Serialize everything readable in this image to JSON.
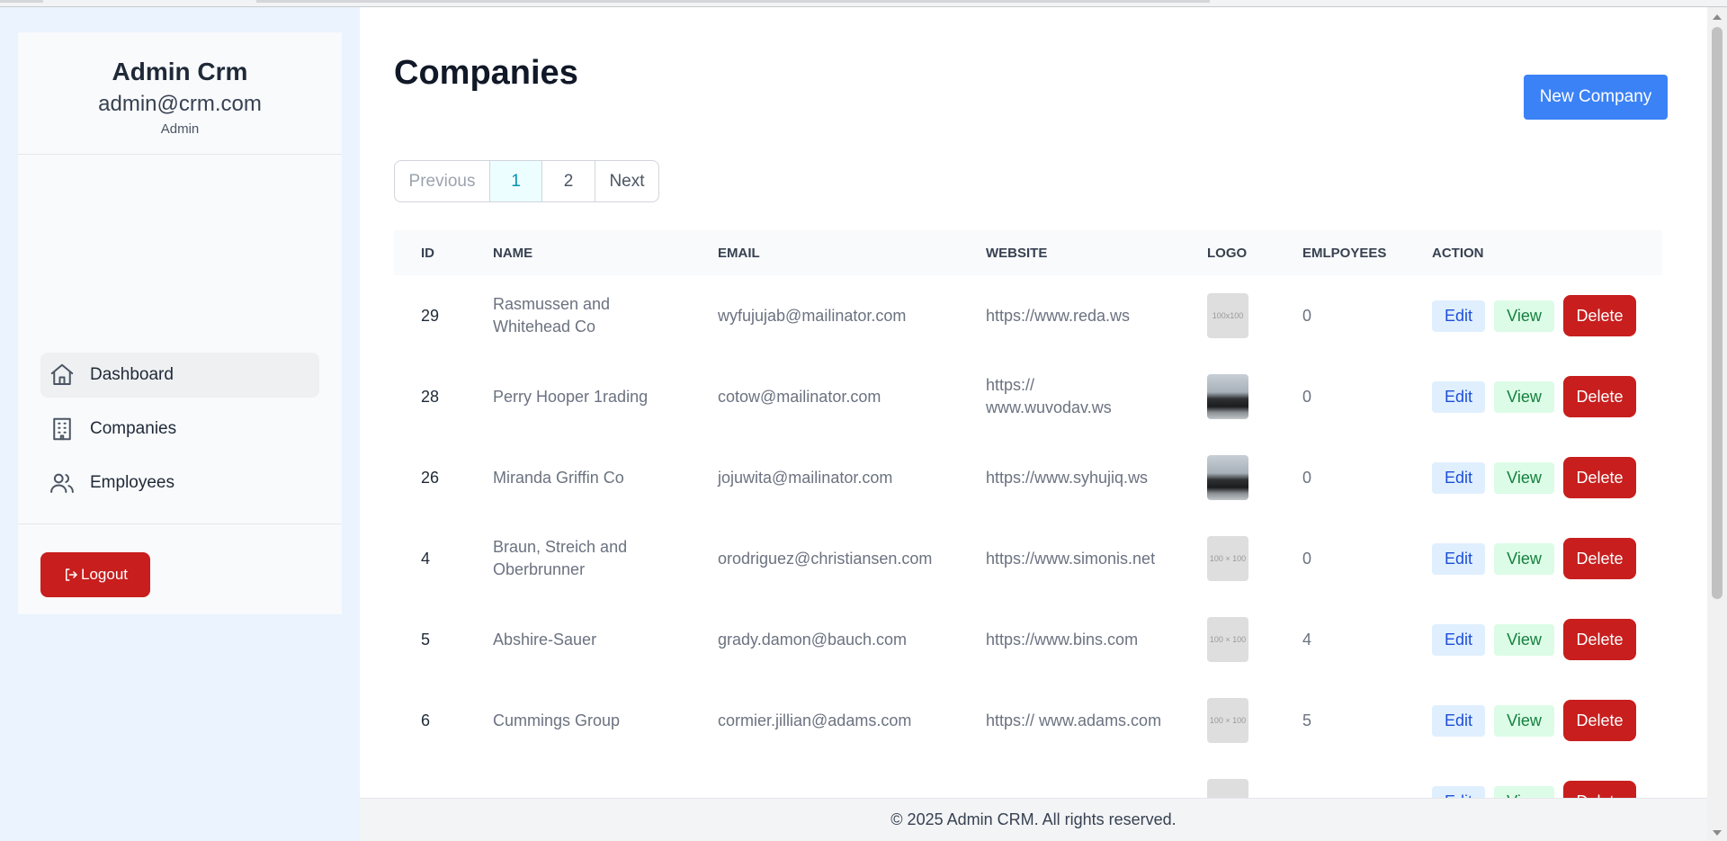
{
  "sidebar": {
    "app_name": "Admin Crm",
    "user_email": "admin@crm.com",
    "user_role": "Admin",
    "nav": [
      {
        "label": "Dashboard",
        "icon": "home-icon",
        "active": true
      },
      {
        "label": "Companies",
        "icon": "building-icon",
        "active": false
      },
      {
        "label": "Employees",
        "icon": "users-icon",
        "active": false
      }
    ],
    "logout_label": "Logout"
  },
  "main": {
    "title": "Companies",
    "new_button": "New Company",
    "pagination": {
      "previous": "Previous",
      "pages": [
        "1",
        "2"
      ],
      "current": "1",
      "next": "Next"
    },
    "columns": [
      "ID",
      "NAME",
      "EMAIL",
      "WEBSITE",
      "LOGO",
      "EMLPOYEES",
      "ACTION"
    ],
    "rows": [
      {
        "id": "29",
        "name": "Rasmussen and Whitehead Co",
        "email": "wyfujujab@mailinator.com",
        "website": "https://www.reda.ws",
        "logo": "100x100",
        "employees": "0"
      },
      {
        "id": "28",
        "name": "Perry Hooper 1rading",
        "email": "cotow@mailinator.com",
        "website": "https:// www.wuvodav.ws",
        "logo": "photo",
        "employees": "0"
      },
      {
        "id": "26",
        "name": "Miranda Griffin Co",
        "email": "jojuwita@mailinator.com",
        "website": "https://www.syhujiq.ws",
        "logo": "photo",
        "employees": "0"
      },
      {
        "id": "4",
        "name": "Braun, Streich and Oberbrunner",
        "email": "orodriguez@christiansen.com",
        "website": "https://www.simonis.net",
        "logo": "100 × 100",
        "employees": "0"
      },
      {
        "id": "5",
        "name": "Abshire-Sauer",
        "email": "grady.damon@bauch.com",
        "website": "https://www.bins.com",
        "logo": "100 × 100",
        "employees": "4"
      },
      {
        "id": "6",
        "name": "Cummings Group",
        "email": "cormier.jillian@adams.com",
        "website": "https:// www.adams.com",
        "logo": "100 × 100",
        "employees": "5"
      }
    ],
    "actions": {
      "edit": "Edit",
      "view": "View",
      "delete": "Delete"
    }
  },
  "footer": {
    "text": "© 2025 Admin CRM. All rights reserved."
  },
  "colors": {
    "primary": "#3b82f6",
    "danger": "#c81e1e",
    "edit_bg": "#e0effe",
    "view_bg": "#dcfce7"
  }
}
